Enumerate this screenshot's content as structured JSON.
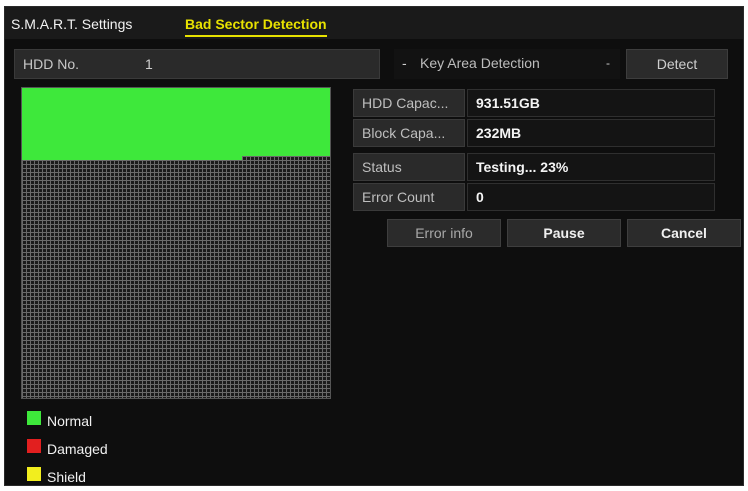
{
  "tabs": [
    {
      "label": "S.M.A.R.T. Settings",
      "active": false
    },
    {
      "label": "Bad Sector Detection",
      "active": true
    }
  ],
  "hdd": {
    "label": "HDD No.",
    "value": "1"
  },
  "detection_mode": {
    "lead": "-",
    "selected": "Key Area Detection",
    "caret": "-"
  },
  "detect_button": "Detect",
  "info": {
    "capacity": {
      "label": "HDD Capac...",
      "value": "931.51GB"
    },
    "block": {
      "label": "Block Capa...",
      "value": "232MB"
    },
    "status": {
      "label": "Status",
      "value": "Testing... 23%"
    },
    "errors": {
      "label": "Error Count",
      "value": "0"
    }
  },
  "progress_fraction": 0.23,
  "buttons": {
    "error_info": "Error info",
    "pause": "Pause",
    "cancel": "Cancel"
  },
  "legend": [
    {
      "label": "Normal",
      "color": "#3ee83b"
    },
    {
      "label": "Damaged",
      "color": "#e21f1f"
    },
    {
      "label": "Shield",
      "color": "#f2ee1e"
    }
  ],
  "colors": {
    "accent": "#e8e200",
    "normal": "#3ee83b"
  }
}
